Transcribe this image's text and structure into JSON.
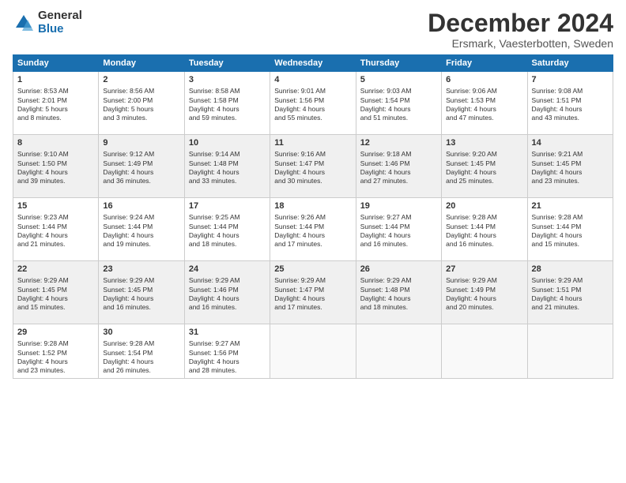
{
  "logo": {
    "general": "General",
    "blue": "Blue"
  },
  "title": "December 2024",
  "subtitle": "Ersmark, Vaesterbotten, Sweden",
  "weekdays": [
    "Sunday",
    "Monday",
    "Tuesday",
    "Wednesday",
    "Thursday",
    "Friday",
    "Saturday"
  ],
  "weeks": [
    [
      {
        "day": "1",
        "info": "Sunrise: 8:53 AM\nSunset: 2:01 PM\nDaylight: 5 hours\nand 8 minutes."
      },
      {
        "day": "2",
        "info": "Sunrise: 8:56 AM\nSunset: 2:00 PM\nDaylight: 5 hours\nand 3 minutes."
      },
      {
        "day": "3",
        "info": "Sunrise: 8:58 AM\nSunset: 1:58 PM\nDaylight: 4 hours\nand 59 minutes."
      },
      {
        "day": "4",
        "info": "Sunrise: 9:01 AM\nSunset: 1:56 PM\nDaylight: 4 hours\nand 55 minutes."
      },
      {
        "day": "5",
        "info": "Sunrise: 9:03 AM\nSunset: 1:54 PM\nDaylight: 4 hours\nand 51 minutes."
      },
      {
        "day": "6",
        "info": "Sunrise: 9:06 AM\nSunset: 1:53 PM\nDaylight: 4 hours\nand 47 minutes."
      },
      {
        "day": "7",
        "info": "Sunrise: 9:08 AM\nSunset: 1:51 PM\nDaylight: 4 hours\nand 43 minutes."
      }
    ],
    [
      {
        "day": "8",
        "info": "Sunrise: 9:10 AM\nSunset: 1:50 PM\nDaylight: 4 hours\nand 39 minutes."
      },
      {
        "day": "9",
        "info": "Sunrise: 9:12 AM\nSunset: 1:49 PM\nDaylight: 4 hours\nand 36 minutes."
      },
      {
        "day": "10",
        "info": "Sunrise: 9:14 AM\nSunset: 1:48 PM\nDaylight: 4 hours\nand 33 minutes."
      },
      {
        "day": "11",
        "info": "Sunrise: 9:16 AM\nSunset: 1:47 PM\nDaylight: 4 hours\nand 30 minutes."
      },
      {
        "day": "12",
        "info": "Sunrise: 9:18 AM\nSunset: 1:46 PM\nDaylight: 4 hours\nand 27 minutes."
      },
      {
        "day": "13",
        "info": "Sunrise: 9:20 AM\nSunset: 1:45 PM\nDaylight: 4 hours\nand 25 minutes."
      },
      {
        "day": "14",
        "info": "Sunrise: 9:21 AM\nSunset: 1:45 PM\nDaylight: 4 hours\nand 23 minutes."
      }
    ],
    [
      {
        "day": "15",
        "info": "Sunrise: 9:23 AM\nSunset: 1:44 PM\nDaylight: 4 hours\nand 21 minutes."
      },
      {
        "day": "16",
        "info": "Sunrise: 9:24 AM\nSunset: 1:44 PM\nDaylight: 4 hours\nand 19 minutes."
      },
      {
        "day": "17",
        "info": "Sunrise: 9:25 AM\nSunset: 1:44 PM\nDaylight: 4 hours\nand 18 minutes."
      },
      {
        "day": "18",
        "info": "Sunrise: 9:26 AM\nSunset: 1:44 PM\nDaylight: 4 hours\nand 17 minutes."
      },
      {
        "day": "19",
        "info": "Sunrise: 9:27 AM\nSunset: 1:44 PM\nDaylight: 4 hours\nand 16 minutes."
      },
      {
        "day": "20",
        "info": "Sunrise: 9:28 AM\nSunset: 1:44 PM\nDaylight: 4 hours\nand 16 minutes."
      },
      {
        "day": "21",
        "info": "Sunrise: 9:28 AM\nSunset: 1:44 PM\nDaylight: 4 hours\nand 15 minutes."
      }
    ],
    [
      {
        "day": "22",
        "info": "Sunrise: 9:29 AM\nSunset: 1:45 PM\nDaylight: 4 hours\nand 15 minutes."
      },
      {
        "day": "23",
        "info": "Sunrise: 9:29 AM\nSunset: 1:45 PM\nDaylight: 4 hours\nand 16 minutes."
      },
      {
        "day": "24",
        "info": "Sunrise: 9:29 AM\nSunset: 1:46 PM\nDaylight: 4 hours\nand 16 minutes."
      },
      {
        "day": "25",
        "info": "Sunrise: 9:29 AM\nSunset: 1:47 PM\nDaylight: 4 hours\nand 17 minutes."
      },
      {
        "day": "26",
        "info": "Sunrise: 9:29 AM\nSunset: 1:48 PM\nDaylight: 4 hours\nand 18 minutes."
      },
      {
        "day": "27",
        "info": "Sunrise: 9:29 AM\nSunset: 1:49 PM\nDaylight: 4 hours\nand 20 minutes."
      },
      {
        "day": "28",
        "info": "Sunrise: 9:29 AM\nSunset: 1:51 PM\nDaylight: 4 hours\nand 21 minutes."
      }
    ],
    [
      {
        "day": "29",
        "info": "Sunrise: 9:28 AM\nSunset: 1:52 PM\nDaylight: 4 hours\nand 23 minutes."
      },
      {
        "day": "30",
        "info": "Sunrise: 9:28 AM\nSunset: 1:54 PM\nDaylight: 4 hours\nand 26 minutes."
      },
      {
        "day": "31",
        "info": "Sunrise: 9:27 AM\nSunset: 1:56 PM\nDaylight: 4 hours\nand 28 minutes."
      },
      {
        "day": "",
        "info": ""
      },
      {
        "day": "",
        "info": ""
      },
      {
        "day": "",
        "info": ""
      },
      {
        "day": "",
        "info": ""
      }
    ]
  ]
}
